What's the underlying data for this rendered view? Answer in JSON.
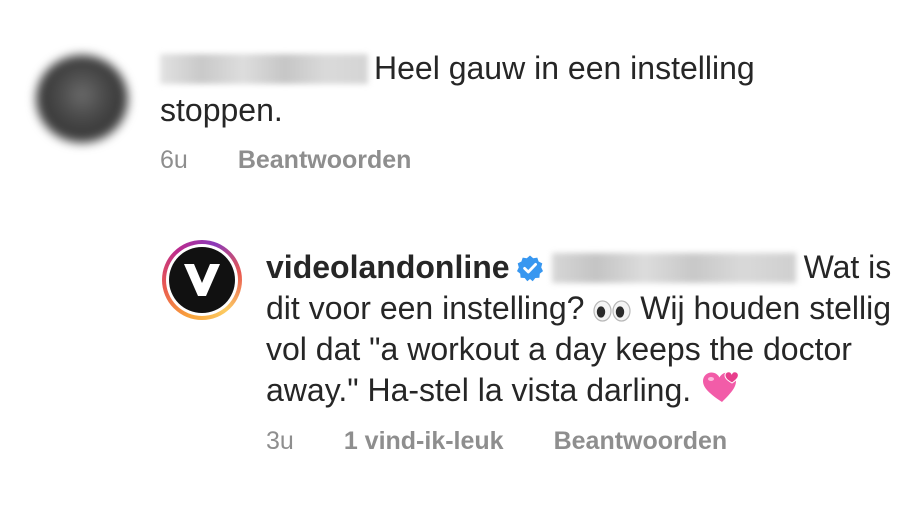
{
  "comment1": {
    "text": "Heel gauw in een instelling stoppen.",
    "time": "6u",
    "reply_label": "Beantwoorden"
  },
  "comment2": {
    "username": "videolandonline",
    "text_after_mention": "Wat is dit voor een instelling?",
    "text_after_eyes": "Wij houden stellig vol dat \"a workout a day keeps the doctor away.\" Ha-stel la vista darling.",
    "time": "3u",
    "likes_label": "1 vind-ik-leuk",
    "reply_label": "Beantwoorden",
    "verified_color": "#3897f0"
  },
  "icons": {
    "eyes": "eyes-emoji",
    "hearts": "two-hearts-emoji",
    "verified": "verified-badge-icon"
  }
}
